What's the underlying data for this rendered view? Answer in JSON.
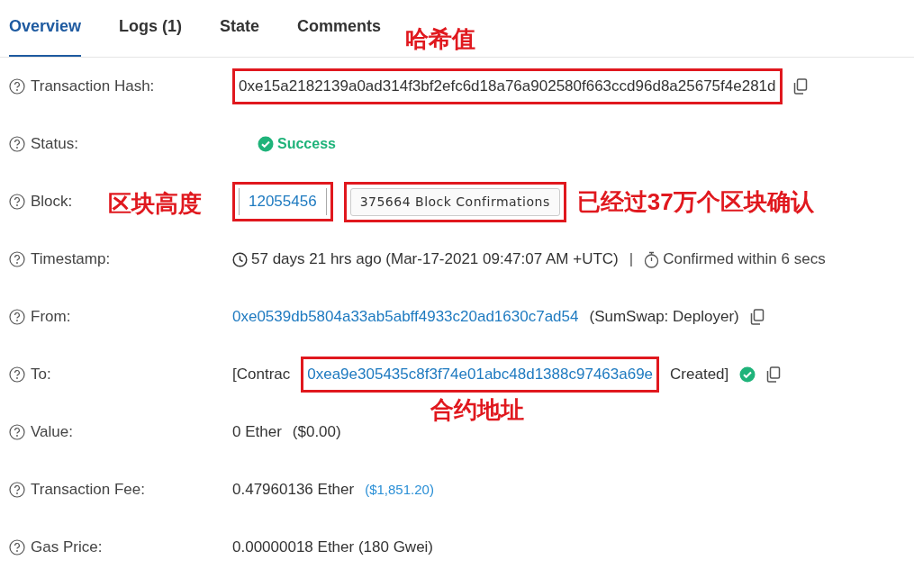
{
  "tabs": [
    {
      "label": "Overview",
      "selected": true
    },
    {
      "label": "Logs (1)",
      "selected": false
    },
    {
      "label": "State",
      "selected": false
    },
    {
      "label": "Comments",
      "selected": false
    }
  ],
  "rows": [
    {
      "label": "Transaction Hash:",
      "note": {
        "text": "哈希值",
        "kind": "above"
      },
      "parts": [
        {
          "kind": "text",
          "text": "0xe15a2182139a0ad314f3bf2efc6d18a76a902580f663ccd96d8a25675f4e281d",
          "boxed": true
        },
        {
          "kind": "copy"
        }
      ]
    },
    {
      "label": "Status:",
      "parts": [
        {
          "kind": "success",
          "text": "Success"
        }
      ]
    },
    {
      "label": "Block:",
      "note": {
        "text": "区块高度",
        "kind": "left"
      },
      "parts": [
        {
          "kind": "block",
          "text": "12055456",
          "boxed": true
        },
        {
          "kind": "badge",
          "text": "375664 Block Confirmations",
          "boxed": true
        },
        {
          "kind": "note",
          "text": "已经过37万个区块确认"
        }
      ]
    },
    {
      "label": "Timestamp:",
      "parts": [
        {
          "kind": "clock",
          "text": "57 days 21 hrs ago (Mar-17-2021 09:47:07 AM +UTC)"
        },
        {
          "kind": "sep",
          "text": "|"
        },
        {
          "kind": "timer",
          "text": "Confirmed within 6 secs"
        }
      ]
    },
    {
      "label": "From:",
      "parts": [
        {
          "kind": "link",
          "text": "0xe0539db5804a33ab5abff4933c20ad1630c7ad54"
        },
        {
          "kind": "text",
          "text": "(SumSwap: Deployer)"
        },
        {
          "kind": "copy"
        }
      ]
    },
    {
      "label": "To:",
      "note": {
        "text": "合约地址",
        "kind": "below"
      },
      "parts": [
        {
          "kind": "text",
          "text": "[Contrac"
        },
        {
          "kind": "link",
          "text": "0xea9e305435c8f3f74e01abc48d1388c97463a69e",
          "boxed": true
        },
        {
          "kind": "text",
          "text": "Created]"
        },
        {
          "kind": "verified"
        },
        {
          "kind": "copy"
        }
      ]
    },
    {
      "label": "Value:",
      "parts": [
        {
          "kind": "text",
          "text": "0 Ether"
        },
        {
          "kind": "text",
          "text": "($0.00)"
        }
      ]
    },
    {
      "label": "Transaction Fee:",
      "parts": [
        {
          "kind": "text",
          "text": "0.47960136 Ether"
        },
        {
          "kind": "small_link",
          "text": "($1,851.20)"
        }
      ]
    },
    {
      "label": "Gas Price:",
      "parts": [
        {
          "kind": "text",
          "text": "0.00000018 Ether (180 Gwei)"
        }
      ]
    }
  ]
}
